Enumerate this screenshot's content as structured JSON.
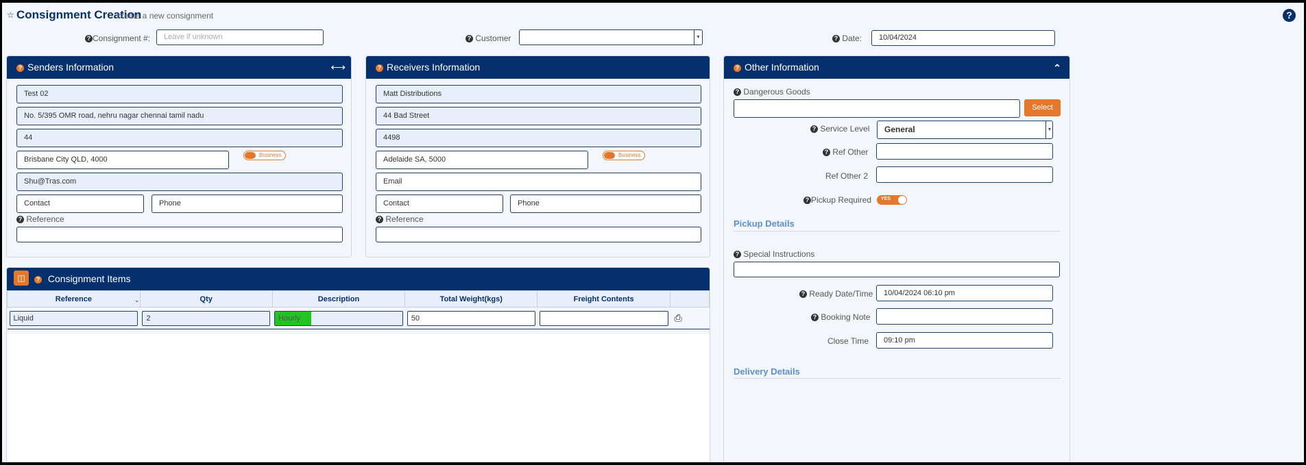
{
  "header": {
    "title": "Consignment Creation",
    "subtitle": "create a new consignment",
    "consignment_label": "Consignment #:",
    "consignment_placeholder": "Leave if unknown",
    "customer_label": "Customer",
    "customer_value": "",
    "date_label": "Date:",
    "date_value": "10/04/2024"
  },
  "senders": {
    "title": "Senders Information",
    "name": "Test 02",
    "address": "No. 5/395 OMR road, nehru nagar chennai tamil nadu",
    "line2": "44",
    "city": "Brisbane City QLD, 4000",
    "toggle_label": "Business",
    "email": "Shu@Tras.com",
    "contact_placeholder": "Contact",
    "phone_placeholder": "Phone",
    "reference_label": "Reference",
    "reference_value": ""
  },
  "receivers": {
    "title": "Receivers Information",
    "name": "Matt Distributions",
    "address": "44 Bad Street",
    "line2": "4498",
    "city": "Adelaide SA, 5000",
    "toggle_label": "Business",
    "email_placeholder": "Email",
    "contact_placeholder": "Contact",
    "phone_placeholder": "Phone",
    "reference_label": "Reference",
    "reference_value": ""
  },
  "other": {
    "title": "Other Information",
    "dangerous_goods_label": "Dangerous Goods",
    "dangerous_goods_value": "",
    "select_button": "Select",
    "service_level_label": "Service Level",
    "service_level_value": "General",
    "ref_other_label": "Ref Other",
    "ref_other_2_label": "Ref Other 2",
    "pickup_required_label": "Pickup Required",
    "pickup_toggle": "YES",
    "pickup_details_title": "Pickup Details",
    "special_instructions_label": "Special Instructions",
    "ready_label": "Ready Date/Time",
    "ready_value": "10/04/2024 06:10 pm",
    "booking_note_label": "Booking Note",
    "close_time_label": "Close Time",
    "close_time_value": "09:10 pm",
    "delivery_details_title": "Delivery Details"
  },
  "items": {
    "title": "Consignment Items",
    "columns": [
      "Reference",
      "Qty",
      "Description",
      "Total Weight(kgs)",
      "Freight Contents"
    ],
    "rows": [
      {
        "reference": "Liquid",
        "qty": "2",
        "description": "Hourly",
        "weight": "50",
        "freight": ""
      }
    ]
  },
  "icons": [
    "star-icon",
    "help-icon",
    "question-icon",
    "expand-horizontal-icon",
    "chevron-up-icon",
    "columns-icon",
    "print-icon",
    "dropdown-caret-icon"
  ],
  "colors": {
    "navy": "#06306d",
    "accent": "#e3782b",
    "link_blue": "#5a8fd0",
    "highlight": "#22c322"
  }
}
